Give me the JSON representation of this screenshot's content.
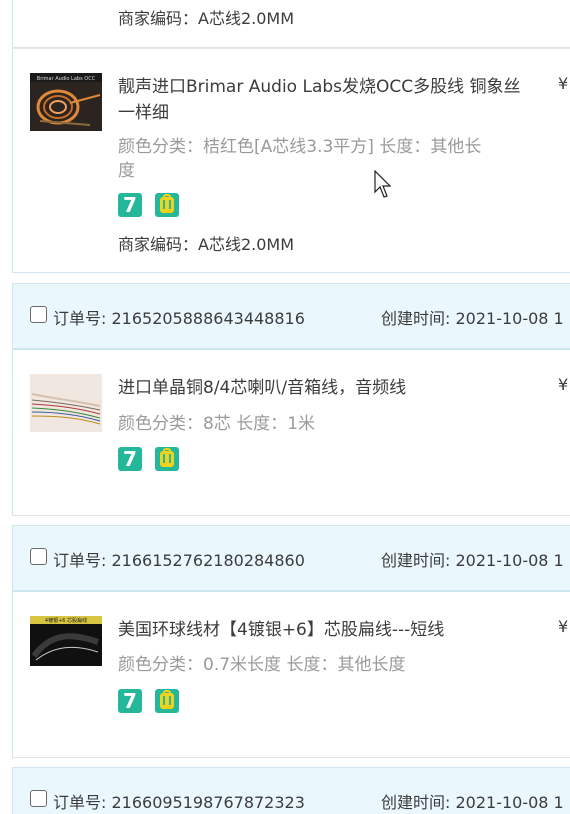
{
  "top_fragment": {
    "merchant_code": "商家编码：A芯线2.0MM"
  },
  "items": [
    {
      "title_line1": "靓声进口Brimar Audio Labs发烧OCC多股线 铜象丝",
      "title_line2": "一样细",
      "attr_line1": "颜色分类：桔红色[A芯线3.3平方]  长度：其他长",
      "attr_line2": "度",
      "merchant_code": "商家编码：A芯线2.0MM",
      "price": "¥",
      "thumb_caption": "Brimar Audio Labs OCC"
    },
    {
      "order_no": "订单号: 2165205888643448816",
      "created": "创建时间: 2021-10-08 1",
      "title_line1": "进口单晶铜8/4芯喇叭/音箱线，音频线",
      "attr_line1": "颜色分类：8芯  长度：1米",
      "price": "¥"
    },
    {
      "order_no": "订单号: 2166152762180284860",
      "created": "创建时间: 2021-10-08 1",
      "title_line1": "美国环球线材【4镀银+6】芯股扁线---短线",
      "attr_line1": "颜色分类：0.7米长度  长度：其他长度",
      "price": "¥",
      "thumb_caption": "4镀银+6 芯股扁线"
    }
  ],
  "last_header": {
    "order_no": "订单号: 2166095198767872323",
    "created": "创建时间: 2021-10-08 1"
  },
  "badges": {
    "seven_day": "7"
  },
  "colors": {
    "header_bg": "#eaf8fe",
    "badge_green": "#25b79a",
    "badge_yellow": "#f2d21b",
    "muted_text": "#9a9a9a"
  }
}
